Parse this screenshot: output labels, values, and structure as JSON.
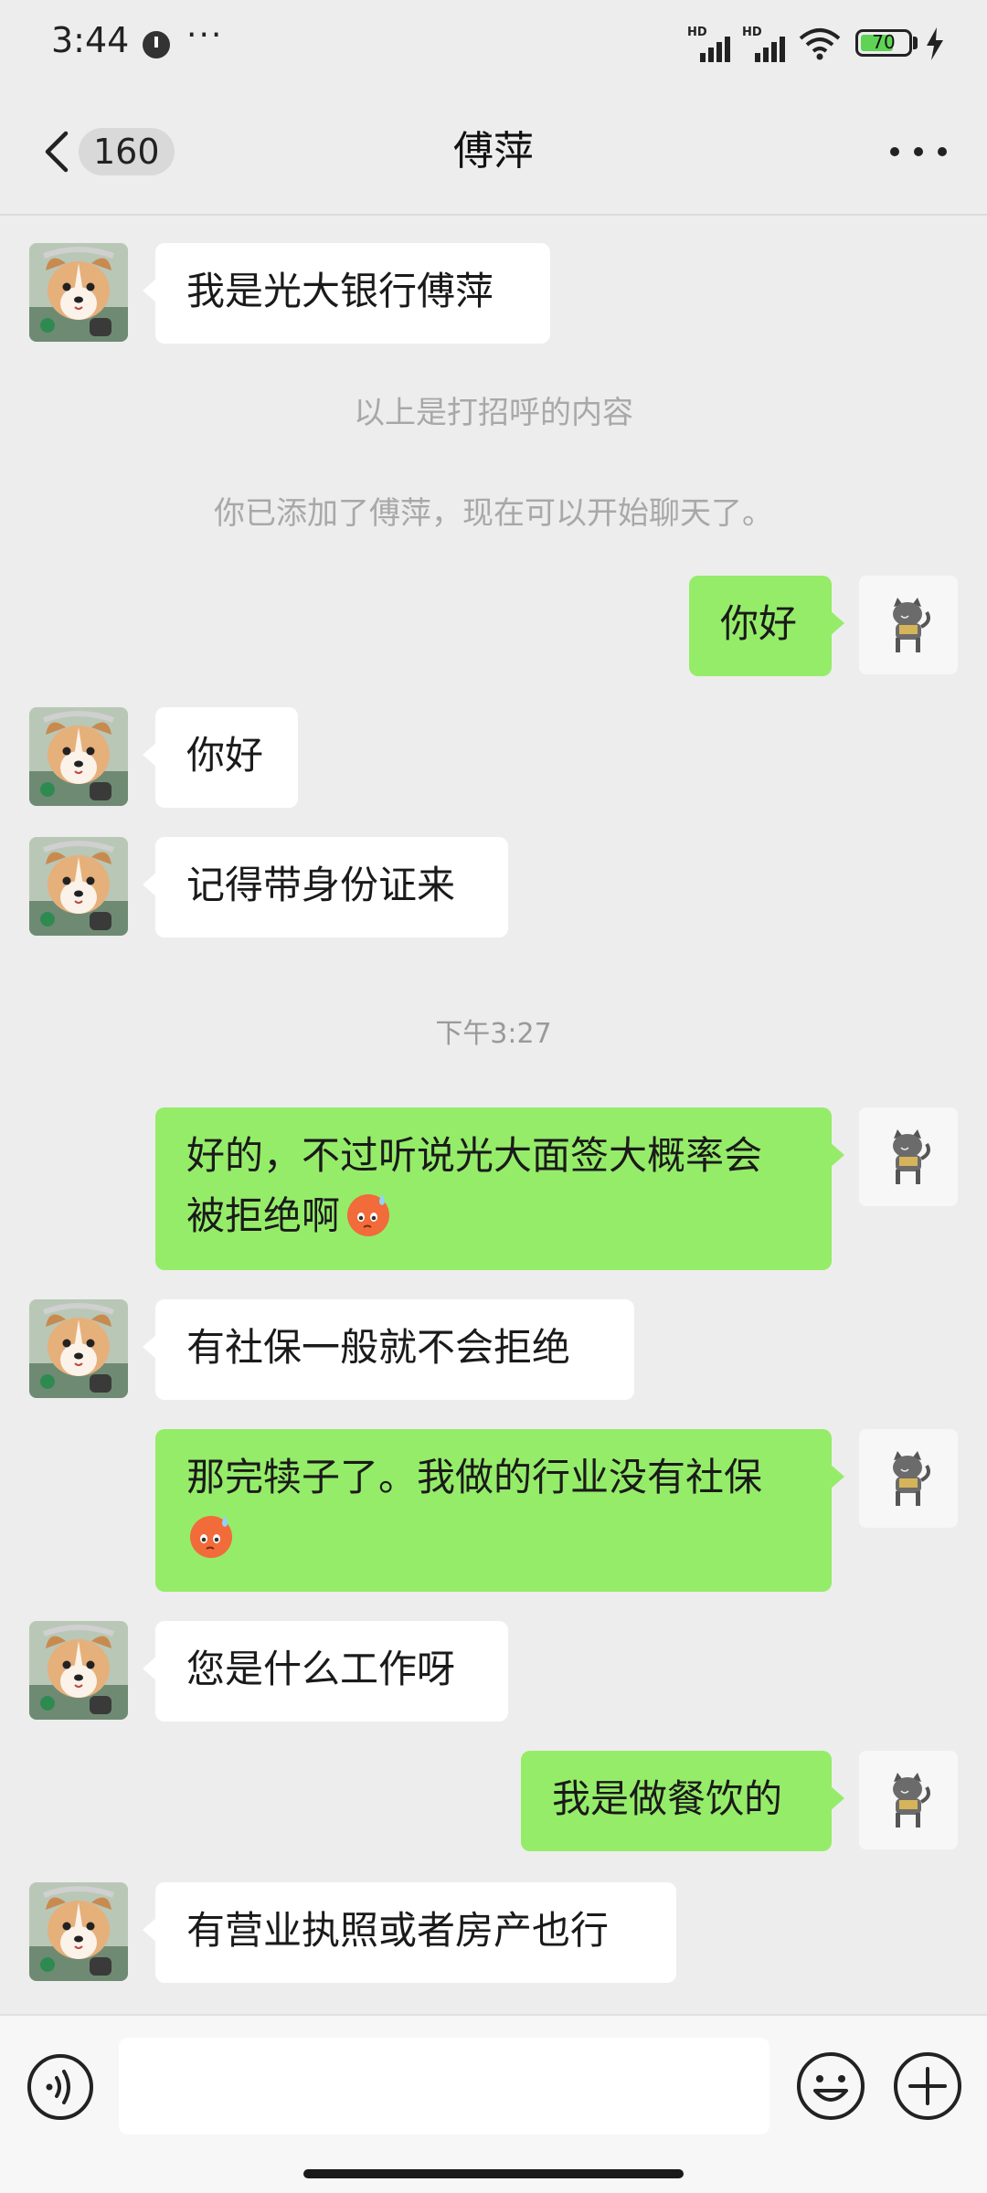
{
  "status_bar": {
    "time": "3:44",
    "more": "···",
    "signal_label_1": "HD",
    "signal_label_2": "HD",
    "battery_percent": 70,
    "battery_text": "70",
    "icons": [
      "alarm-icon",
      "signal-icon",
      "wifi-icon",
      "battery-icon",
      "charging-icon"
    ]
  },
  "nav": {
    "back_icon": "chevron-left-icon",
    "unread_count": "160",
    "title": "傅萍",
    "more_icon": "more-dots-icon"
  },
  "messages": [
    {
      "id": "m1",
      "side": "in",
      "text": "我是光大银行傅萍"
    },
    {
      "id": "n1",
      "type": "system",
      "text": "以上是打招呼的内容"
    },
    {
      "id": "n2",
      "type": "system",
      "text": "你已添加了傅萍，现在可以开始聊天了。"
    },
    {
      "id": "m2",
      "side": "out",
      "text": "你好"
    },
    {
      "id": "m3",
      "side": "in",
      "text": "你好"
    },
    {
      "id": "m4",
      "side": "in",
      "text": "记得带身份证来"
    },
    {
      "id": "t1",
      "type": "timestamp",
      "text": "下午3:27"
    },
    {
      "id": "m5",
      "side": "out",
      "line1": "好的，不过听说光大面签大概率会",
      "line2": "被拒绝啊",
      "emoji": "sweat-face-emoji"
    },
    {
      "id": "m6",
      "side": "in",
      "text": "有社保一般就不会拒绝"
    },
    {
      "id": "m7",
      "side": "out",
      "line1": "那完犊子了。我做的行业没有社保",
      "emoji": "sweat-face-emoji"
    },
    {
      "id": "m8",
      "side": "in",
      "text": "您是什么工作呀"
    },
    {
      "id": "m9",
      "side": "out",
      "text": "我是做餐饮的"
    },
    {
      "id": "m10",
      "side": "in",
      "text": "有营业执照或者房产也行"
    }
  ],
  "input_bar": {
    "voice_icon": "voice-icon",
    "input_value": "",
    "emoji_icon": "emoji-icon",
    "plus_icon": "plus-icon"
  },
  "colors": {
    "background": "#ededed",
    "incoming_bubble": "#ffffff",
    "outgoing_bubble": "#95ec69",
    "system_text": "#a8a8a8"
  }
}
